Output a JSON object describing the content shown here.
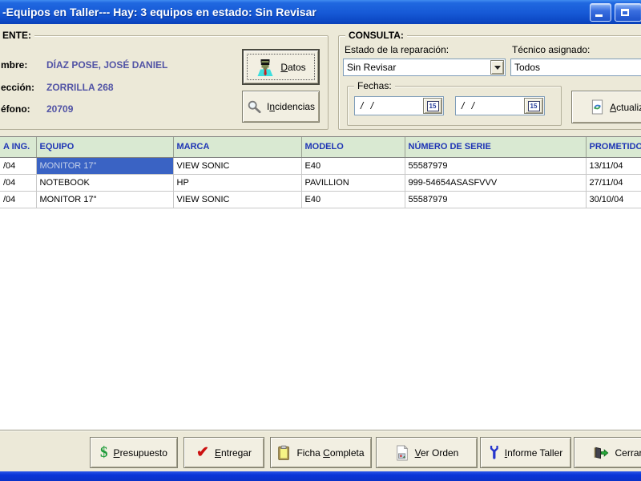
{
  "window": {
    "title": "-Equipos en Taller--- Hay: 3 equipos en estado: Sin Revisar"
  },
  "cliente": {
    "group_label": "ENTE:",
    "fields": [
      {
        "label": "mbre:",
        "value": "DÍAZ POSE, JOSÉ DANIEL"
      },
      {
        "label": "ección:",
        "value": "ZORRILLA 268"
      },
      {
        "label": "éfono:",
        "value": "20709"
      }
    ],
    "datos_button": {
      "pre": "",
      "key": "D",
      "post": "atos"
    },
    "incidencias_button": {
      "pre": "I",
      "key": "n",
      "post": "cidencias"
    }
  },
  "consulta": {
    "group_label": "CONSULTA:",
    "estado_label": "Estado de la reparación:",
    "estado_value": "Sin Revisar",
    "tecnico_label": "Técnico asignado:",
    "tecnico_value": "Todos",
    "fechas_label": "Fechas:",
    "fecha_desde": "/ /",
    "fecha_hasta": "/ /",
    "calendar_glyph": "15",
    "actualizar_button": {
      "pre": "",
      "key": "A",
      "post": "ctualizar"
    }
  },
  "grid": {
    "columns": [
      "A ING.",
      "EQUIPO",
      "MARCA",
      "MODELO",
      "NÚMERO DE SERIE",
      "PROMETIDO"
    ],
    "rows": [
      [
        "/04",
        "MONITOR 17\"",
        "VIEW SONIC",
        "E40",
        "55587979",
        "13/11/04"
      ],
      [
        "/04",
        "NOTEBOOK",
        "HP",
        "PAVILLION",
        "999-54654ASASFVVV",
        "27/11/04"
      ],
      [
        "/04",
        "MONITOR 17\"",
        "VIEW SONIC",
        "E40",
        "55587979",
        "30/10/04"
      ]
    ],
    "selected_cell": {
      "row": 0,
      "column": 1
    }
  },
  "footer": {
    "buttons": [
      {
        "pre": "",
        "key": "P",
        "post": "resupuesto"
      },
      {
        "pre": "",
        "key": "E",
        "post": "ntregar"
      },
      {
        "pre": "Ficha ",
        "key": "C",
        "post": "ompleta"
      },
      {
        "pre": "",
        "key": "V",
        "post": "er Orden"
      },
      {
        "pre": "",
        "key": "I",
        "post": "nforme Taller"
      },
      {
        "pre": "Cerrar",
        "key": "",
        "post": ""
      }
    ]
  },
  "colors": {
    "titlebar_blue": "#1659d6",
    "form_bg": "#ECE9D8",
    "grid_header_bg": "#D9E9D2",
    "grid_header_text": "#1F35B5",
    "selected_cell_bg": "#3A63C4",
    "client_value_text": "#5153A5",
    "bottom_bar_blue": "#0A36D8"
  }
}
